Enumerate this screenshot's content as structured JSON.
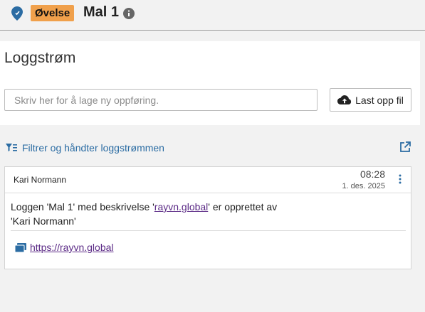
{
  "header": {
    "badge": "Øvelse",
    "title": "Mal 1"
  },
  "panel": {
    "title": "Loggstrøm",
    "input_placeholder": "Skriv her for å lage ny oppføring.",
    "upload_label": "Last opp fil"
  },
  "filter": {
    "label": "Filtrer og håndter loggstrømmen"
  },
  "entry": {
    "author": "Kari Normann",
    "time": "08:28",
    "date": "1. des. 2025",
    "message_prefix": "Loggen 'Mal 1' med beskrivelse '",
    "message_link": "rayvn.global",
    "message_suffix": "' er opprettet av 'Kari Normann'",
    "attachment_link": "https://rayvn.global"
  },
  "colors": {
    "accent": "#2b6ca3",
    "badge": "#f0a04b",
    "link": "#5b2a86"
  },
  "icons": [
    "location-pin-icon",
    "info-icon",
    "cloud-upload-icon",
    "filter-icon",
    "external-link-icon",
    "kebab-menu-icon",
    "link-card-icon"
  ]
}
